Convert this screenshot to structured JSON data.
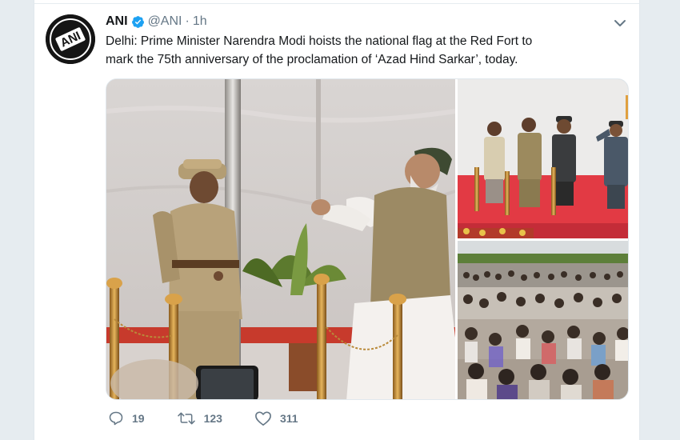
{
  "tweet": {
    "display_name": "ANI",
    "handle": "@ANI",
    "separator": "·",
    "time": "1h",
    "text_line1": "Delhi: Prime Minister Narendra Modi hoists the national flag at the Red Fort to",
    "text_line2": "mark the 75th anniversary of the proclamation of ‘Azad Hind Sarkar’, today.",
    "avatar_logo_text": "ANI",
    "verified": true
  },
  "actions": {
    "replies": "19",
    "retweets": "123",
    "likes": "311"
  },
  "icons": {
    "reply": "reply-icon",
    "retweet": "retweet-icon",
    "like": "heart-icon",
    "menu": "chevron-down-icon",
    "verified": "verified-badge-icon"
  },
  "colors": {
    "verified_blue": "#1da1f2",
    "text_primary": "#14171a",
    "text_secondary": "#657786",
    "background": "#e6ecf0"
  }
}
